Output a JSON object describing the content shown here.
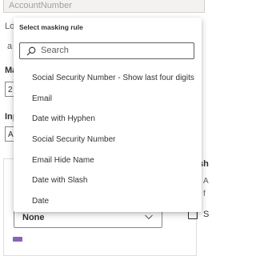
{
  "background": {
    "top_field_value": "AccountNumber",
    "label_fragments": [
      "Lo",
      "a",
      "Ma",
      "2",
      "Inp",
      "A",
      "sh",
      "A",
      "f",
      "S"
    ],
    "select_value": "None"
  },
  "dropdown": {
    "title": "Select masking rule",
    "search_placeholder": "Search",
    "items": [
      "Social Security Number - Show last four digits",
      "Email",
      "Date with Hyphen",
      "Social Security Number",
      "Email Hide Name",
      "Date with Slash",
      "Date"
    ]
  },
  "colors": {
    "border": "#8a8886",
    "text": "#323130",
    "muted": "#605e5c",
    "accent": "#8764b8"
  },
  "icons": [
    "search-icon",
    "chevron-down-icon",
    "checkbox-icon"
  ]
}
